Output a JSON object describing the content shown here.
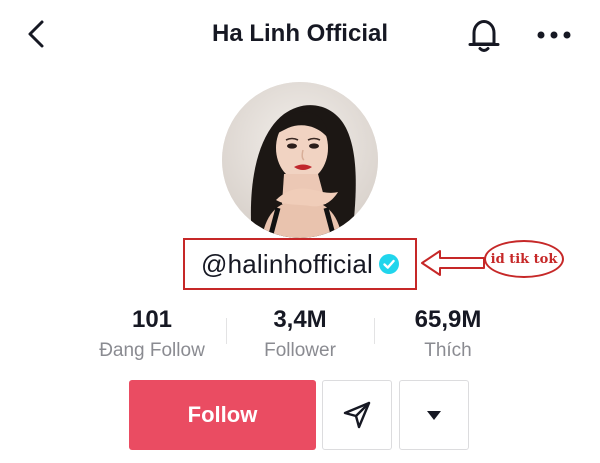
{
  "header": {
    "title": "Ha Linh Official",
    "back_icon": "chevron-left-icon",
    "bell_icon": "bell-icon",
    "more_icon": "more-dots-icon"
  },
  "profile": {
    "username": "@halinhofficial",
    "verified": true,
    "avatar": "profile-photo"
  },
  "annotation": {
    "label": "id tik tok",
    "color": "#c62828"
  },
  "stats": [
    {
      "value": "101",
      "label": "Đang Follow"
    },
    {
      "value": "3,4M",
      "label": "Follower"
    },
    {
      "value": "65,9M",
      "label": "Thích"
    }
  ],
  "actions": {
    "follow_label": "Follow",
    "follow_color": "#ea4c62",
    "share_icon": "send-icon",
    "dropdown_icon": "caret-down-icon"
  }
}
